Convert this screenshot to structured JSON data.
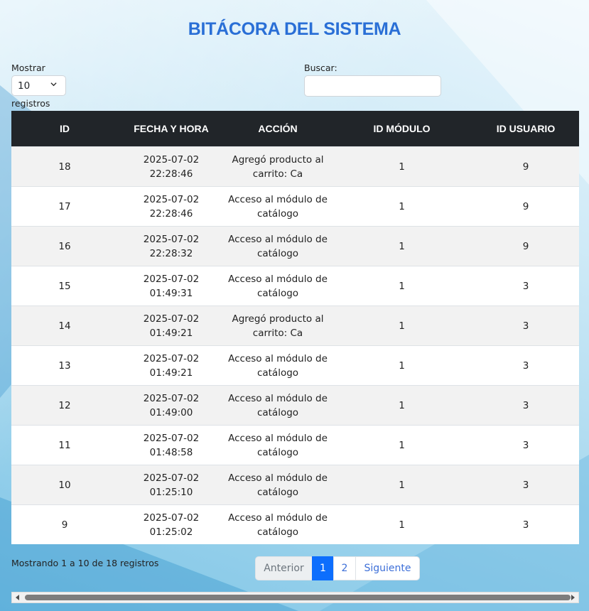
{
  "title": "BITÁCORA DEL SISTEMA",
  "length_menu": {
    "label": "Mostrar",
    "value": "10",
    "suffix": "registros"
  },
  "search": {
    "label": "Buscar:",
    "value": ""
  },
  "table": {
    "headers": [
      "ID",
      "FECHA Y HORA",
      "ACCIÓN",
      "ID MÓDULO",
      "ID USUARIO"
    ],
    "rows": [
      [
        "18",
        "2025-07-02 22:28:46",
        "Agregó producto al carrito: Ca",
        "1",
        "9"
      ],
      [
        "17",
        "2025-07-02 22:28:46",
        "Acceso al módulo de catálogo",
        "1",
        "9"
      ],
      [
        "16",
        "2025-07-02 22:28:32",
        "Acceso al módulo de catálogo",
        "1",
        "9"
      ],
      [
        "15",
        "2025-07-02 01:49:31",
        "Acceso al módulo de catálogo",
        "1",
        "3"
      ],
      [
        "14",
        "2025-07-02 01:49:21",
        "Agregó producto al carrito: Ca",
        "1",
        "3"
      ],
      [
        "13",
        "2025-07-02 01:49:21",
        "Acceso al módulo de catálogo",
        "1",
        "3"
      ],
      [
        "12",
        "2025-07-02 01:49:00",
        "Acceso al módulo de catálogo",
        "1",
        "3"
      ],
      [
        "11",
        "2025-07-02 01:48:58",
        "Acceso al módulo de catálogo",
        "1",
        "3"
      ],
      [
        "10",
        "2025-07-02 01:25:10",
        "Acceso al módulo de catálogo",
        "1",
        "3"
      ],
      [
        "9",
        "2025-07-02 01:25:02",
        "Acceso al módulo de catálogo",
        "1",
        "3"
      ]
    ]
  },
  "info": "Mostrando 1 a 10 de 18 registros",
  "pagination": {
    "prev": "Anterior",
    "pages": [
      "1",
      "2"
    ],
    "active": "1",
    "next": "Siguiente"
  },
  "colors": {
    "title": "#2a6fd6",
    "header_bg": "#212529",
    "active_page": "#0d6efd"
  },
  "icons": {
    "select": "chevron-down-icon",
    "scroll_left": "triangle-left-icon",
    "scroll_right": "triangle-right-icon"
  }
}
